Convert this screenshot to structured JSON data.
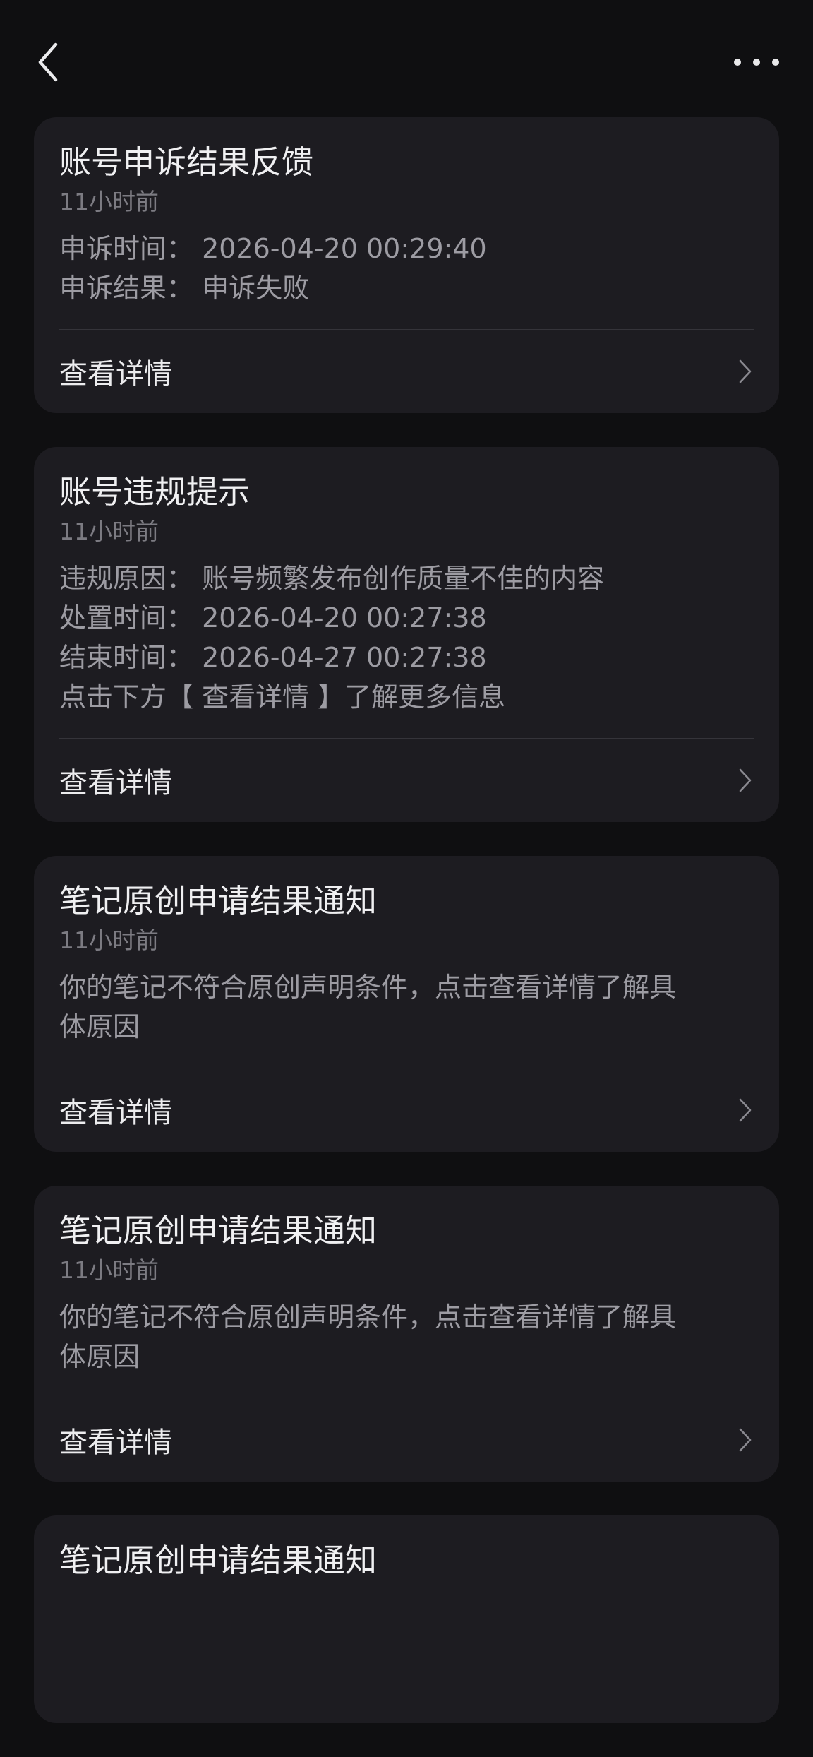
{
  "nav": {
    "back_icon": "chevron-left-icon",
    "more_icon": "more-horizontal-icon",
    "title": ""
  },
  "cards": [
    {
      "title": "账号申诉结果反馈",
      "time": "11小时前",
      "lines": [
        "申诉时间： 2026-04-20 00:29:40",
        "申诉结果： 申诉失败"
      ],
      "action": "查看详情"
    },
    {
      "title": "账号违规提示",
      "time": "11小时前",
      "lines": [
        "违规原因： 账号频繁发布创作质量不佳的内容",
        "处置时间： 2026-04-20 00:27:38",
        "结束时间： 2026-04-27 00:27:38",
        "点击下方【 查看详情 】了解更多信息"
      ],
      "action": "查看详情"
    },
    {
      "title": "笔记原创申请结果通知",
      "time": "11小时前",
      "lines": [
        "你的笔记不符合原创声明条件，点击查看详情了解具",
        "体原因"
      ],
      "action": "查看详情"
    },
    {
      "title": "笔记原创申请结果通知",
      "time": "11小时前",
      "lines": [
        "你的笔记不符合原创声明条件，点击查看详情了解具",
        "体原因"
      ],
      "action": "查看详情"
    },
    {
      "title": "笔记原创申请结果通知",
      "time": "",
      "lines": [],
      "action": ""
    }
  ]
}
